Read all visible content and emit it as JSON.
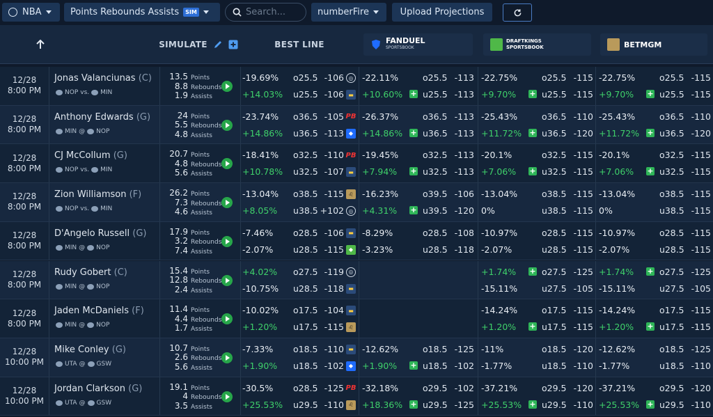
{
  "toolbar": {
    "league": "NBA",
    "market": "Points Rebounds Assists",
    "sim_badge": "SIM",
    "search_placeholder": "Search...",
    "projection_source": "numberFire",
    "upload_label": "Upload Projections"
  },
  "header": {
    "simulate": "SIMULATE",
    "best_line": "BEST LINE",
    "books": [
      {
        "name": "FANDUEL",
        "sub": "SPORTSBOOK"
      },
      {
        "name": "DRAFTKINGS",
        "sub": "SPORTSBOOK"
      },
      {
        "name": "BETMGM",
        "sub": ""
      }
    ],
    "stat_labels": {
      "points": "Points",
      "rebounds": "Rebounds",
      "assists": "Assists"
    }
  },
  "rows": [
    {
      "date": "12/28",
      "time": "8:00 PM",
      "name": "Jonas Valanciunas",
      "pos": "(C)",
      "team1": "NOP",
      "sep": "vs.",
      "team2": "MIN",
      "points": "13.5",
      "rebounds": "8.8",
      "assists": "1.9",
      "best": [
        [
          "-19.69%",
          "o25.5",
          "-106",
          "cz"
        ],
        [
          "+14.03%",
          "u25.5",
          "-106",
          "bl"
        ]
      ],
      "fd": [
        [
          "-22.11%",
          "o25.5",
          "-113",
          false
        ],
        [
          "+10.60%",
          "u25.5",
          "-113",
          true
        ]
      ],
      "dk": [
        [
          "-22.75%",
          "o25.5",
          "-115",
          false
        ],
        [
          "+9.70%",
          "u25.5",
          "-115",
          true
        ]
      ],
      "mgm": [
        [
          "-22.75%",
          "o25.5",
          "-115",
          false
        ],
        [
          "+9.70%",
          "u25.5",
          "-115",
          true
        ]
      ]
    },
    {
      "date": "12/28",
      "time": "8:00 PM",
      "name": "Anthony Edwards",
      "pos": "(G)",
      "team1": "MIN",
      "sep": "@",
      "team2": "NOP",
      "points": "24",
      "rebounds": "5.5",
      "assists": "4.8",
      "best": [
        [
          "-23.74%",
          "o36.5",
          "-105",
          "pb"
        ],
        [
          "+14.86%",
          "u36.5",
          "-113",
          "fd"
        ]
      ],
      "fd": [
        [
          "-26.37%",
          "o36.5",
          "-113",
          false
        ],
        [
          "+14.86%",
          "u36.5",
          "-113",
          true
        ]
      ],
      "dk": [
        [
          "-25.43%",
          "o36.5",
          "-110",
          false
        ],
        [
          "+11.72%",
          "u36.5",
          "-120",
          true
        ]
      ],
      "mgm": [
        [
          "-25.43%",
          "o36.5",
          "-110",
          false
        ],
        [
          "+11.72%",
          "u36.5",
          "-120",
          true
        ]
      ]
    },
    {
      "date": "12/28",
      "time": "8:00 PM",
      "name": "CJ McCollum",
      "pos": "(G)",
      "team1": "NOP",
      "sep": "vs.",
      "team2": "MIN",
      "points": "20.7",
      "rebounds": "4.8",
      "assists": "5.6",
      "best": [
        [
          "-18.41%",
          "o32.5",
          "-110",
          "pb"
        ],
        [
          "+10.78%",
          "u32.5",
          "-107",
          "bl"
        ]
      ],
      "fd": [
        [
          "-19.45%",
          "o32.5",
          "-113",
          false
        ],
        [
          "+7.94%",
          "u32.5",
          "-113",
          true
        ]
      ],
      "dk": [
        [
          "-20.1%",
          "o32.5",
          "-115",
          false
        ],
        [
          "+7.06%",
          "u32.5",
          "-115",
          true
        ]
      ],
      "mgm": [
        [
          "-20.1%",
          "o32.5",
          "-115",
          false
        ],
        [
          "+7.06%",
          "u32.5",
          "-115",
          true
        ]
      ]
    },
    {
      "date": "12/28",
      "time": "8:00 PM",
      "name": "Zion Williamson",
      "pos": "(F)",
      "team1": "NOP",
      "sep": "vs.",
      "team2": "MIN",
      "points": "26.2",
      "rebounds": "7.3",
      "assists": "4.6",
      "best": [
        [
          "-13.04%",
          "o38.5",
          "-115",
          "mgm"
        ],
        [
          "+8.05%",
          "u38.5",
          "+102",
          "cz"
        ]
      ],
      "fd": [
        [
          "-16.23%",
          "o39.5",
          "-106",
          false
        ],
        [
          "+4.31%",
          "u39.5",
          "-120",
          true
        ]
      ],
      "dk": [
        [
          "-13.04%",
          "o38.5",
          "-115",
          false
        ],
        [
          "0%",
          "u38.5",
          "-115",
          false
        ]
      ],
      "mgm": [
        [
          "-13.04%",
          "o38.5",
          "-115",
          false
        ],
        [
          "0%",
          "u38.5",
          "-115",
          false
        ]
      ]
    },
    {
      "date": "12/28",
      "time": "8:00 PM",
      "name": "D'Angelo Russell",
      "pos": "(G)",
      "team1": "MIN",
      "sep": "@",
      "team2": "NOP",
      "points": "17.9",
      "rebounds": "3.2",
      "assists": "7.4",
      "best": [
        [
          "-7.46%",
          "o28.5",
          "-106",
          "bl"
        ],
        [
          "-2.07%",
          "u28.5",
          "-115",
          "dk"
        ]
      ],
      "fd": [
        [
          "-8.29%",
          "o28.5",
          "-108",
          false
        ],
        [
          "-3.23%",
          "u28.5",
          "-118",
          false
        ]
      ],
      "dk": [
        [
          "-10.97%",
          "o28.5",
          "-115",
          false
        ],
        [
          "-2.07%",
          "u28.5",
          "-115",
          false
        ]
      ],
      "mgm": [
        [
          "-10.97%",
          "o28.5",
          "-115",
          false
        ],
        [
          "-2.07%",
          "u28.5",
          "-115",
          false
        ]
      ]
    },
    {
      "date": "12/28",
      "time": "8:00 PM",
      "name": "Rudy Gobert",
      "pos": "(C)",
      "team1": "MIN",
      "sep": "@",
      "team2": "NOP",
      "points": "15.4",
      "rebounds": "12.8",
      "assists": "2.4",
      "best": [
        [
          "+4.02%",
          "o27.5",
          "-119",
          "cz"
        ],
        [
          "-10.75%",
          "u28.5",
          "-118",
          "bl"
        ]
      ],
      "fd": [],
      "dk": [
        [
          "+1.74%",
          "o27.5",
          "-125",
          true
        ],
        [
          "-15.11%",
          "u27.5",
          "-105",
          false
        ]
      ],
      "mgm": [
        [
          "+1.74%",
          "o27.5",
          "-125",
          true
        ],
        [
          "-15.11%",
          "u27.5",
          "-105",
          false
        ]
      ]
    },
    {
      "date": "12/28",
      "time": "8:00 PM",
      "name": "Jaden McDaniels",
      "pos": "(F)",
      "team1": "MIN",
      "sep": "@",
      "team2": "NOP",
      "points": "11.4",
      "rebounds": "4.4",
      "assists": "1.7",
      "best": [
        [
          "-10.02%",
          "o17.5",
          "-104",
          "bl"
        ],
        [
          "+1.20%",
          "u17.5",
          "-115",
          "mgm"
        ]
      ],
      "fd": [],
      "dk": [
        [
          "-14.24%",
          "o17.5",
          "-115",
          false
        ],
        [
          "+1.20%",
          "u17.5",
          "-115",
          true
        ]
      ],
      "mgm": [
        [
          "-14.24%",
          "o17.5",
          "-115",
          false
        ],
        [
          "+1.20%",
          "u17.5",
          "-115",
          true
        ]
      ]
    },
    {
      "date": "12/28",
      "time": "10:00 PM",
      "name": "Mike Conley",
      "pos": "(G)",
      "team1": "UTA",
      "sep": "@",
      "team2": "GSW",
      "points": "10.7",
      "rebounds": "2.6",
      "assists": "5.6",
      "best": [
        [
          "-7.33%",
          "o18.5",
          "-110",
          "bl"
        ],
        [
          "+1.90%",
          "u18.5",
          "-102",
          "fd"
        ]
      ],
      "fd": [
        [
          "-12.62%",
          "o18.5",
          "-125",
          false
        ],
        [
          "+1.90%",
          "u18.5",
          "-102",
          true
        ]
      ],
      "dk": [
        [
          "-11%",
          "o18.5",
          "-120",
          false
        ],
        [
          "-1.77%",
          "u18.5",
          "-110",
          false
        ]
      ],
      "mgm": [
        [
          "-12.62%",
          "o18.5",
          "-125",
          false
        ],
        [
          "-1.77%",
          "u18.5",
          "-110",
          false
        ]
      ]
    },
    {
      "date": "12/28",
      "time": "10:00 PM",
      "name": "Jordan Clarkson",
      "pos": "(G)",
      "team1": "UTA",
      "sep": "@",
      "team2": "GSW",
      "points": "19.1",
      "rebounds": "4",
      "assists": "3.5",
      "best": [
        [
          "-30.5%",
          "o28.5",
          "-125",
          "pb"
        ],
        [
          "+25.53%",
          "u29.5",
          "-110",
          "mgm"
        ]
      ],
      "fd": [
        [
          "-32.18%",
          "o29.5",
          "-102",
          false
        ],
        [
          "+18.36%",
          "u29.5",
          "-125",
          true
        ]
      ],
      "dk": [
        [
          "-37.21%",
          "o29.5",
          "-120",
          false
        ],
        [
          "+25.53%",
          "u29.5",
          "-110",
          true
        ]
      ],
      "mgm": [
        [
          "-37.21%",
          "o29.5",
          "-120",
          false
        ],
        [
          "+25.53%",
          "u29.5",
          "-110",
          true
        ]
      ]
    }
  ],
  "colors": {
    "bg": "#0f1a2b",
    "row": "#132337",
    "positive": "#3fd06a",
    "accent": "#2e6fd6",
    "play": "#27a64a"
  }
}
